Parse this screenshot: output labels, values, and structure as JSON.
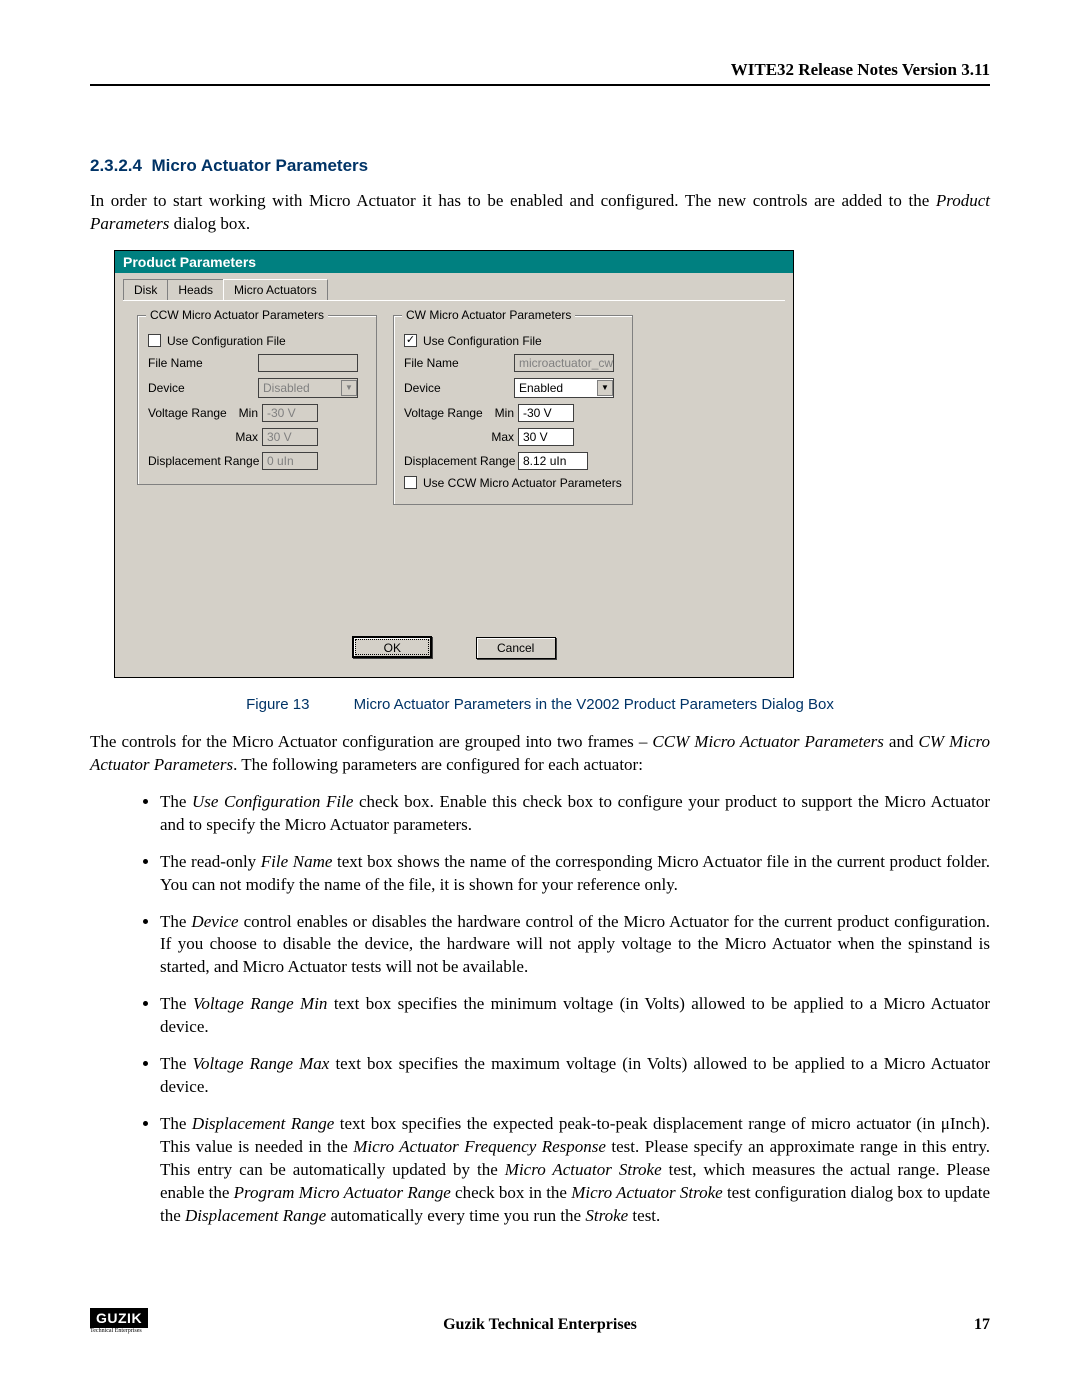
{
  "header": {
    "title": "WITE32 Release Notes Version 3.11"
  },
  "section": {
    "number": "2.3.2.4",
    "title": "Micro Actuator Parameters"
  },
  "intro": {
    "pre": "In order to start working with Micro Actuator it has to be enabled and configured. The new controls are added to the ",
    "italic": "Product Parameters",
    "post": " dialog box."
  },
  "dialog": {
    "title": "Product Parameters",
    "tabs": [
      "Disk",
      "Heads",
      "Micro Actuators"
    ],
    "active_tab": 2,
    "ccw": {
      "legend": "CCW Micro Actuator Parameters",
      "use_cfg_label": "Use Configuration File",
      "use_cfg_checked": false,
      "file_name_label": "File Name",
      "file_name_value": "",
      "device_label": "Device",
      "device_value": "Disabled",
      "device_enabled": false,
      "vrange_label": "Voltage Range",
      "min_label": "Min",
      "min_value": "-30 V",
      "max_label": "Max",
      "max_value": "30 V",
      "disp_label": "Displacement Range",
      "disp_value": "0 uIn"
    },
    "cw": {
      "legend": "CW Micro Actuator Parameters",
      "use_cfg_label": "Use Configuration File",
      "use_cfg_checked": true,
      "file_name_label": "File Name",
      "file_name_value": "microactuator_cw",
      "device_label": "Device",
      "device_value": "Enabled",
      "device_enabled": true,
      "vrange_label": "Voltage Range",
      "min_label": "Min",
      "min_value": "-30 V",
      "max_label": "Max",
      "max_value": "30 V",
      "disp_label": "Displacement Range",
      "disp_value": "8.12 uIn",
      "use_ccw_label": "Use CCW Micro Actuator Parameters",
      "use_ccw_checked": false
    },
    "ok": "OK",
    "cancel": "Cancel"
  },
  "figure": {
    "num": "Figure 13",
    "caption": "Micro Actuator Parameters in the V2002 Product Parameters Dialog Box"
  },
  "para2": {
    "t1": "The controls for the Micro Actuator configuration are grouped into two frames – ",
    "i1": "CCW Micro Actuator Parameters",
    "t2": " and ",
    "i2": "CW Micro Actuator Parameters",
    "t3": ". The following parameters are configured for each actuator:"
  },
  "bullets": [
    {
      "pre": "The ",
      "i1": "Use Configuration File",
      "mid": " check box. Enable this check box to configure your product to support the Micro Actuator and to specify the Micro Actuator parameters."
    },
    {
      "pre": "The read-only ",
      "i1": "File Name",
      "mid": " text box shows the name of the corresponding Micro Actuator file in the current product folder. You can not modify the name of the file, it is shown for your reference only."
    },
    {
      "pre": "The ",
      "i1": "Device",
      "mid": " control enables or disables the hardware control of the Micro Actuator for the current product configuration. If you choose to disable the device, the hardware will not apply voltage to the Micro Actuator when the spinstand is started, and Micro Actuator tests will not be available."
    },
    {
      "pre": "The ",
      "i1": "Voltage Range Min",
      "mid": " text box specifies the minimum voltage (in Volts) allowed to be applied to a Micro Actuator device."
    },
    {
      "pre": "The ",
      "i1": "Voltage Range Max",
      "mid": " text box specifies the maximum voltage (in Volts) allowed to be applied to a Micro Actuator device."
    },
    {
      "pre": "The ",
      "i1": "Displacement Range",
      "mid": " text box specifies the expected peak-to-peak displacement range of micro actuator (in μInch).  This value is needed in the ",
      "i2": "Micro Actuator Frequency Response",
      "mid2": " test. Please specify an approximate range in this entry. This entry can be automatically updated by the ",
      "i3": "Micro Actuator Stroke",
      "mid3": " test, which measures the actual range. Please enable the ",
      "i4": "Program Micro Actuator Range",
      "mid4": " check box in the ",
      "i5": "Micro Actuator Stroke",
      "mid5": " test configuration dialog box to update the ",
      "i6": "Displacement Range",
      "mid6": " automatically every time you run the ",
      "i7": "Stroke",
      "mid7": " test."
    }
  ],
  "footer": {
    "logo": "GUZIK",
    "logo_sub": "Technical Enterprises",
    "center": "Guzik Technical Enterprises",
    "page": "17"
  }
}
